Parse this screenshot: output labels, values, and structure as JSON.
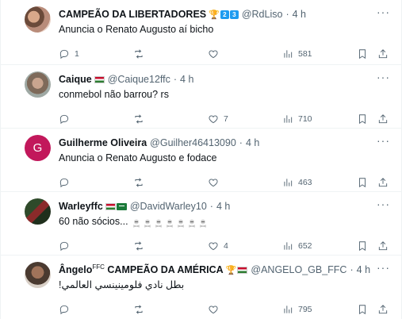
{
  "colors": {
    "accent": "#1d9bf0",
    "muted": "#536471",
    "divider": "#eff3f4",
    "text": "#0f1419",
    "avatar_g": "#c2185b"
  },
  "tweets": [
    {
      "name": "CAMPEÃO DA LIBERTADORES",
      "flair": [
        "trophy-icon",
        "2",
        "3"
      ],
      "handle": "@RdLiso",
      "time": "4 h",
      "text": "Anuncia o Renato Augusto aí bicho",
      "replies": "1",
      "retweets": "",
      "likes": "",
      "views": "581",
      "avatar": "photo"
    },
    {
      "name": "Caique",
      "flair": [
        "hungary-flag-icon"
      ],
      "handle": "@Caique12ffc",
      "time": "4 h",
      "text": "conmebol não barrou? rs",
      "replies": "",
      "retweets": "",
      "likes": "7",
      "views": "710",
      "avatar": "photo"
    },
    {
      "name": "Guilherme Oliveira",
      "flair": [],
      "handle": "@Guilher46413090",
      "time": "4 h",
      "text": "Anuncia o Renato Augusto e fodace",
      "replies": "",
      "retweets": "",
      "likes": "",
      "views": "463",
      "avatar": "G"
    },
    {
      "name": "Warleyffc",
      "flair": [
        "hungary-flag-icon",
        "saudi-flag-icon"
      ],
      "handle": "@DavidWarley10",
      "time": "4 h",
      "text": "60 não sócios...",
      "skulls": 7,
      "replies": "",
      "retweets": "",
      "likes": "4",
      "views": "652",
      "avatar": "photo"
    },
    {
      "name": "Ângelo",
      "name_sup": "FFC",
      "name_rest": "CAMPEÃO DA AMÉRICA",
      "flair": [
        "trophy-icon",
        "hungary-flag-icon"
      ],
      "handle": "@ANGELO_GB_FFC",
      "time": "4 h",
      "text": "بطل نادي فلومينينسي العالمي!",
      "replies": "",
      "retweets": "",
      "likes": "",
      "views": "795",
      "avatar": "photo"
    }
  ],
  "sep": "·"
}
